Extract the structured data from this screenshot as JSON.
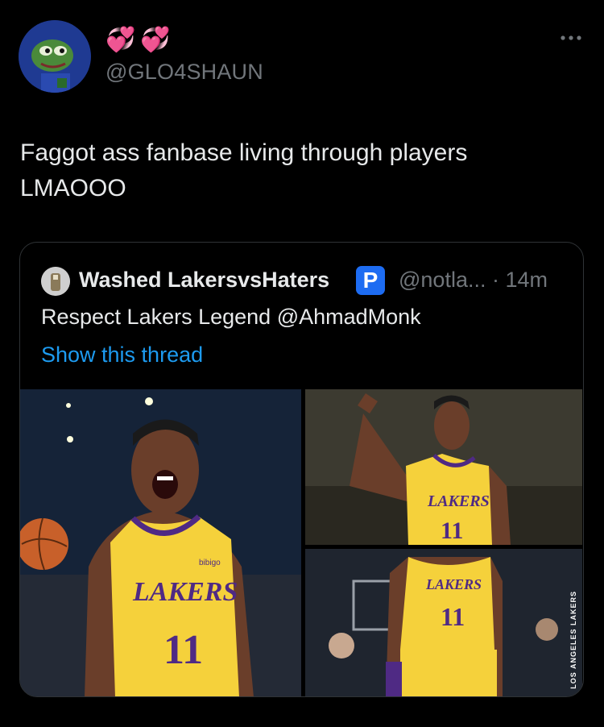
{
  "author": {
    "emojis": [
      "💞",
      "💞"
    ],
    "handle": "@GLO4SHAUN"
  },
  "tweet": {
    "text": "Faggot ass fanbase living through players LMAOOO"
  },
  "quote": {
    "name": "Washed LakersvsHaters",
    "badge": "P",
    "meta": "@notla... · 14m",
    "text": "Respect Lakers Legend @AhmadMonk",
    "show_thread": "Show this thread"
  },
  "images": {
    "main_jersey_team": "LAKERS",
    "main_jersey_number": "11",
    "main_sponsor": "bibigo",
    "tr_jersey_team": "LAKERS",
    "tr_jersey_number": "11",
    "br_jersey_team": "LAKERS",
    "br_jersey_number": "11",
    "vertical_caption": "LOS ANGELES LAKERS"
  },
  "colors": {
    "background": "#000000",
    "text": "#e7e9ea",
    "secondary": "#71767b",
    "link": "#1d9bf0",
    "border": "#2f3336",
    "lakers_gold": "#f5d13b",
    "lakers_purple": "#4f2a84"
  }
}
